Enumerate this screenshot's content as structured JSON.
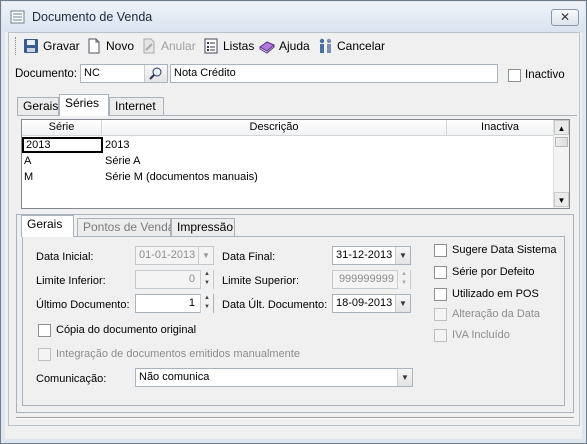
{
  "window": {
    "title": "Documento de Venda",
    "close_symbol": "✕"
  },
  "toolbar": {
    "save_label": "Gravar",
    "new_label": "Novo",
    "cancel_doc_label": "Anular",
    "lists_label": "Listas",
    "help_label": "Ajuda",
    "cancel_label": "Cancelar"
  },
  "document": {
    "label": "Documento:",
    "code": "NC",
    "description": "Nota Crédito",
    "inactive_label": "Inactivo",
    "inactive_checked": false
  },
  "top_tabs": [
    {
      "label": "Gerais",
      "active": false
    },
    {
      "label": "Séries",
      "active": true
    },
    {
      "label": "Internet",
      "active": false
    }
  ],
  "series_table": {
    "columns": [
      "Série",
      "Descrição",
      "Inactiva"
    ],
    "rows": [
      {
        "serie": "2013",
        "descricao": "2013",
        "inactiva": ""
      },
      {
        "serie": "A",
        "descricao": "Série A",
        "inactiva": ""
      },
      {
        "serie": "M",
        "descricao": "Série M (documentos manuais)",
        "inactiva": ""
      }
    ]
  },
  "sub_tabs": [
    {
      "label": "Gerais",
      "active": true
    },
    {
      "label": "Pontos de Venda",
      "active": false
    },
    {
      "label": "Impressão",
      "active": false
    }
  ],
  "form": {
    "data_inicial_label": "Data Inicial:",
    "data_inicial": "01-01-2013",
    "data_final_label": "Data Final:",
    "data_final": "31-12-2013",
    "limite_inferior_label": "Limite Inferior:",
    "limite_inferior": "0",
    "limite_superior_label": "Limite Superior:",
    "limite_superior": "999999999",
    "ultimo_documento_label": "Último Documento:",
    "ultimo_documento": "1",
    "data_ult_documento_label": "Data Últ. Documento:",
    "data_ult_documento": "18-09-2013",
    "copia_label": "Cópia do documento original",
    "integracao_label": "Integração de documentos emitidos manualmente",
    "comunicacao_label": "Comunicação:",
    "comunicacao_value": "Não comunica"
  },
  "options": {
    "sugere_data": "Sugere Data Sistema",
    "serie_defeito": "Série por Defeito",
    "utilizado_pos": "Utilizado em POS",
    "alteracao_data": "Alteração da Data",
    "iva_incluido": "IVA Incluído"
  }
}
